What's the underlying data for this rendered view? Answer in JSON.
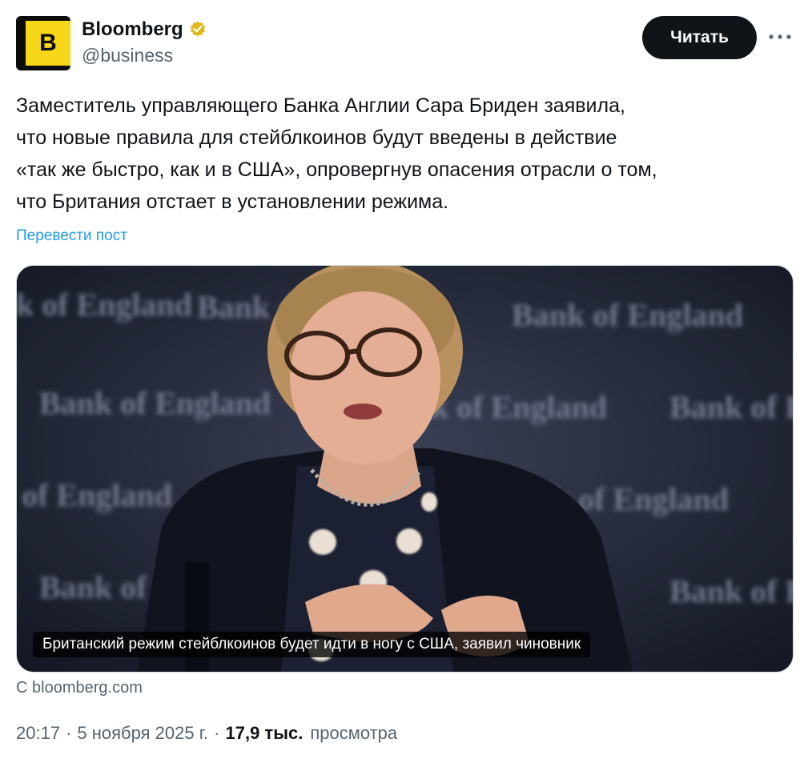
{
  "account": {
    "avatar_letter": "B",
    "display_name": "Bloomberg",
    "handle": "@business",
    "verified_badge": "gold-check-icon"
  },
  "actions": {
    "read_label": "Читать",
    "more_icon": "more-dots-icon"
  },
  "tweet": {
    "lines": [
      "Заместитель управляющего Банка Англии Сара Бриден заявила,",
      "что новые правила для стейблкоинов будут введены в действие",
      "«так же быстро, как и в США», опровергнув опасения отрасли о том,",
      "что Британия отстает в установлении режима."
    ],
    "translate_label": "Перевести пост"
  },
  "media": {
    "background_wordmark": "Bank of England",
    "caption": "Британский режим стейблкоинов будет идти в ногу с США, заявил чиновник"
  },
  "source": {
    "prefix": "С",
    "domain": "bloomberg.com"
  },
  "meta": {
    "time": "20:17",
    "date": "5 ноября 2025 г.",
    "views_count": "17,9 тыс.",
    "views_label": "просмотра"
  },
  "colors": {
    "brand_yellow": "#f8d619",
    "link_blue": "#1d9bf0",
    "verified_gold": "#e2b719",
    "muted_text": "#536471"
  }
}
